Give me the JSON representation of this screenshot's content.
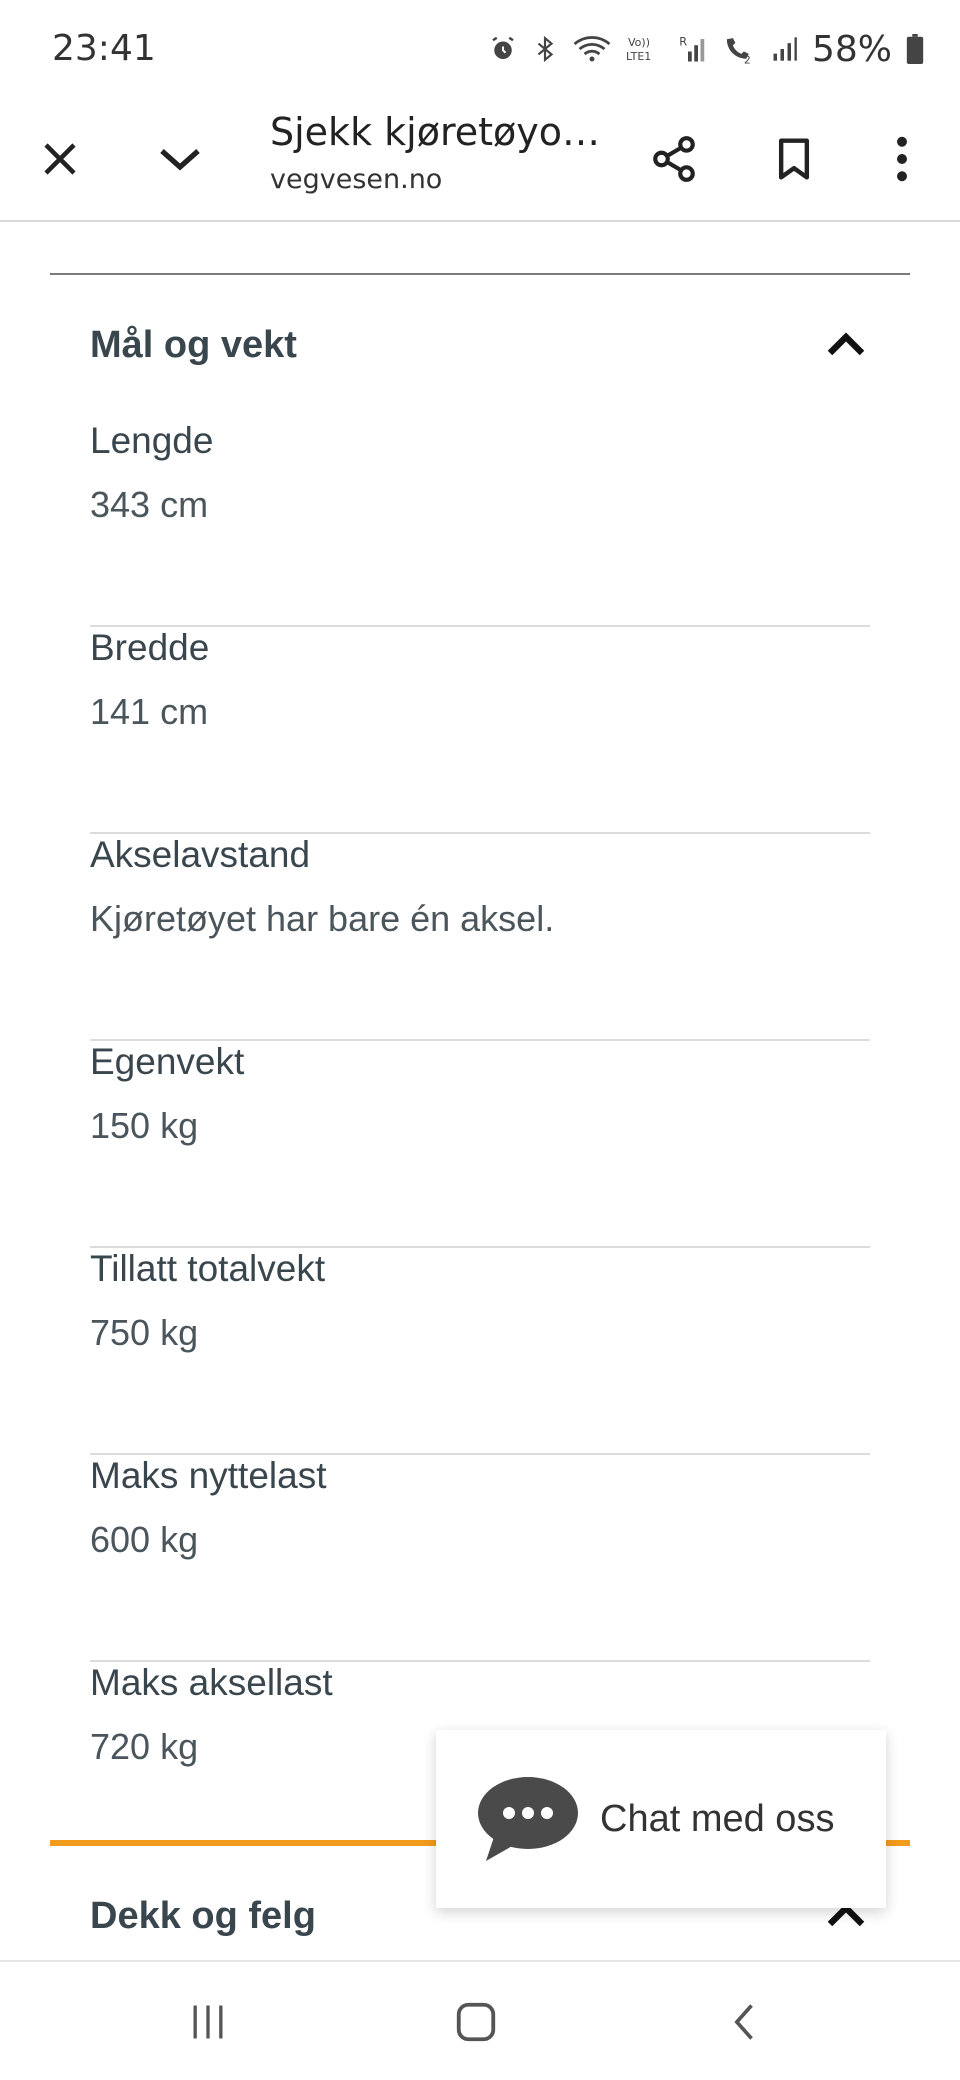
{
  "status_bar": {
    "time": "23:41",
    "battery": "58%",
    "icons": [
      "alarm-icon",
      "bluetooth-icon",
      "wifi-icon",
      "volte-icon",
      "signal-icon",
      "call-icon",
      "signal-2-icon",
      "battery-icon"
    ]
  },
  "browser": {
    "page_title": "Sjekk kjøretøyopplysninger",
    "url": "vegvesen.no",
    "icons": [
      "close-icon",
      "chevron-down-icon",
      "share-icon",
      "bookmark-icon",
      "more-vert-icon"
    ]
  },
  "section_dimensions": {
    "title": "Mål og vekt",
    "expanded": true,
    "items": [
      {
        "label": "Lengde",
        "value": "343 cm"
      },
      {
        "label": "Bredde",
        "value": "141 cm"
      },
      {
        "label": "Akselavstand",
        "value": "Kjøretøyet har bare én aksel."
      },
      {
        "label": "Egenvekt",
        "value": "150 kg"
      },
      {
        "label": "Tillatt totalvekt",
        "value": "750 kg"
      },
      {
        "label": "Maks nyttelast",
        "value": "600 kg"
      },
      {
        "label": "Maks aksellast",
        "value": "720 kg"
      }
    ]
  },
  "section_tires": {
    "title": "Dekk og felg"
  },
  "chat": {
    "label": "Chat med oss"
  },
  "colors": {
    "accent_orange": "#f29c1d",
    "text_dark": "#3a464d",
    "divider": "#dcdcdc"
  },
  "nav": {
    "icons": [
      "recent-apps-icon",
      "home-icon",
      "back-icon"
    ]
  }
}
